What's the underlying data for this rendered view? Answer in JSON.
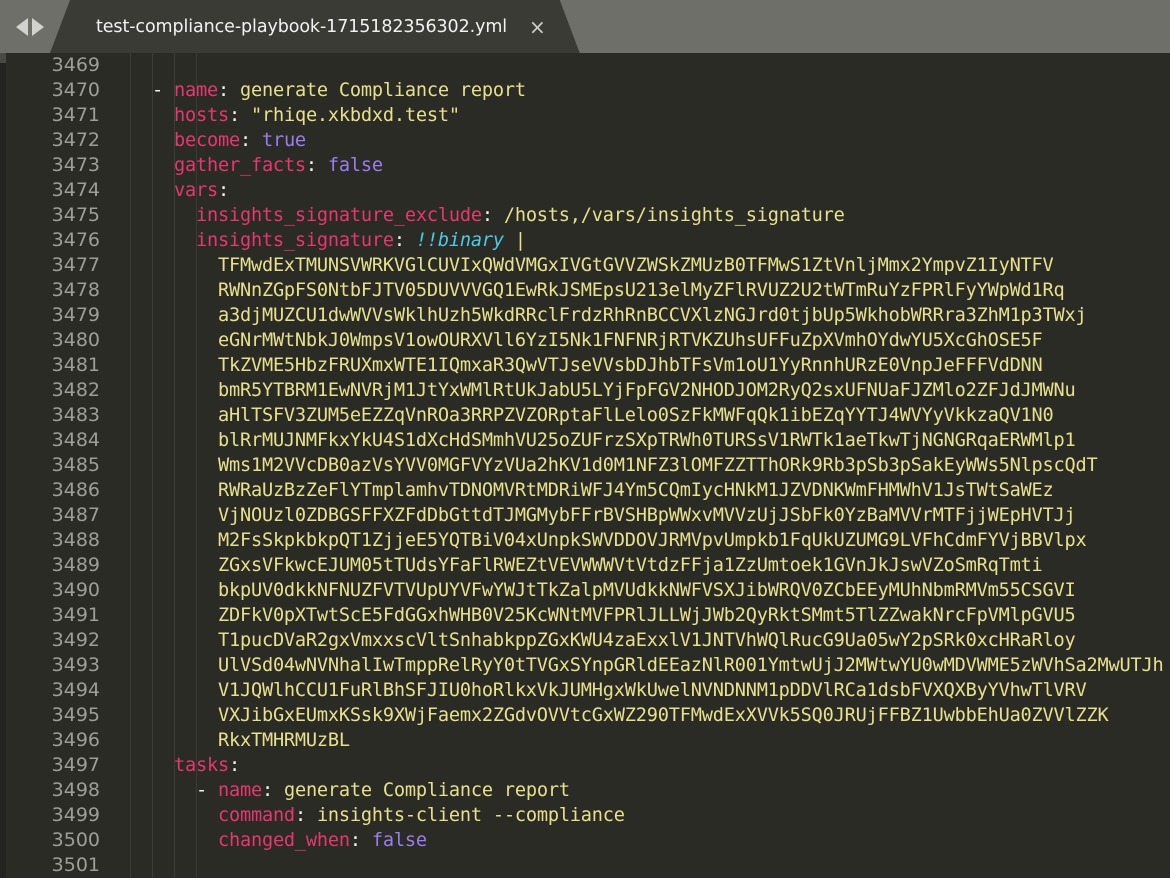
{
  "window": {
    "background": "#2b2b26",
    "tabbar_background": "#6e6f69",
    "tab_background": "#3b3b36"
  },
  "tabbar": {
    "nav_back_icon": "triangle-left",
    "nav_forward_icon": "triangle-right",
    "tab": {
      "title": "test-compliance-playbook-1715182356302.yml",
      "close_label": "×"
    }
  },
  "editor": {
    "language": "yaml",
    "colors": {
      "line_number": "#9d9e97",
      "key": "#e8366f",
      "string": "#e7e08c",
      "boolean": "#9a7ef0",
      "tag": "#4ec9e8",
      "punctuation": "#f2f2ef"
    },
    "first_visible_line": 3469,
    "lines": [
      {
        "num": "3469",
        "indent": 0,
        "tokens": []
      },
      {
        "num": "3470",
        "indent": 0,
        "tokens": [
          {
            "c": "p",
            "v": "  - "
          },
          {
            "c": "k",
            "v": "name"
          },
          {
            "c": "p",
            "v": ": "
          },
          {
            "c": "s",
            "v": "generate Compliance report"
          }
        ]
      },
      {
        "num": "3471",
        "indent": 0,
        "tokens": [
          {
            "c": "p",
            "v": "    "
          },
          {
            "c": "k",
            "v": "hosts"
          },
          {
            "c": "p",
            "v": ": "
          },
          {
            "c": "s",
            "v": "\"rhiqe.xkbdxd.test\""
          }
        ]
      },
      {
        "num": "3472",
        "indent": 0,
        "tokens": [
          {
            "c": "p",
            "v": "    "
          },
          {
            "c": "k",
            "v": "become"
          },
          {
            "c": "p",
            "v": ": "
          },
          {
            "c": "b",
            "v": "true"
          }
        ]
      },
      {
        "num": "3473",
        "indent": 0,
        "tokens": [
          {
            "c": "p",
            "v": "    "
          },
          {
            "c": "k",
            "v": "gather_facts"
          },
          {
            "c": "p",
            "v": ": "
          },
          {
            "c": "b",
            "v": "false"
          }
        ]
      },
      {
        "num": "3474",
        "indent": 0,
        "tokens": [
          {
            "c": "p",
            "v": "    "
          },
          {
            "c": "k",
            "v": "vars"
          },
          {
            "c": "p",
            "v": ":"
          }
        ]
      },
      {
        "num": "3475",
        "indent": 0,
        "tokens": [
          {
            "c": "p",
            "v": "      "
          },
          {
            "c": "k",
            "v": "insights_signature_exclude"
          },
          {
            "c": "p",
            "v": ": "
          },
          {
            "c": "s",
            "v": "/hosts,/vars/insights_signature"
          }
        ]
      },
      {
        "num": "3476",
        "indent": 0,
        "tokens": [
          {
            "c": "p",
            "v": "      "
          },
          {
            "c": "k",
            "v": "insights_signature"
          },
          {
            "c": "p",
            "v": ": "
          },
          {
            "c": "t",
            "v": "!!binary"
          },
          {
            "c": "p",
            "v": " "
          },
          {
            "c": "s",
            "v": "|"
          }
        ]
      },
      {
        "num": "3477",
        "indent": 0,
        "tokens": [
          {
            "c": "p",
            "v": "        "
          },
          {
            "c": "b64",
            "v": "TFMwdExTMUNSVWRKVGlCUVIxQWdVMGxIVGtGVVZWSkZMUzB0TFMwS1ZtVnljMmx2YmpvZ1IyNTFV"
          }
        ]
      },
      {
        "num": "3478",
        "indent": 0,
        "tokens": [
          {
            "c": "p",
            "v": "        "
          },
          {
            "c": "b64",
            "v": "RWNnZGpFS0NtbFJTV05DUVVVGQ1EwRkJSMEpsU213elMyZFlRVUZ2U2tWTmRuYzFPRlFyYWpWd1Rq"
          }
        ]
      },
      {
        "num": "3479",
        "indent": 0,
        "tokens": [
          {
            "c": "p",
            "v": "        "
          },
          {
            "c": "b64",
            "v": "a3djMUZCU1dwWVVsWklhUzh5WkdRRclFrdzRhRnBCCVXlzNGJrd0tjbUp5WkhobWRRra3ZhM1p3TWxj"
          }
        ]
      },
      {
        "num": "3480",
        "indent": 0,
        "tokens": [
          {
            "c": "p",
            "v": "        "
          },
          {
            "c": "b64",
            "v": "eGNrMWtNbkJ0WmpsV1owOURXVll6YzI5Nk1FNFNRjRTVKZUhsUFFuZpXVmhOYdwYU5XcGhOSE5F"
          }
        ]
      },
      {
        "num": "3481",
        "indent": 0,
        "tokens": [
          {
            "c": "p",
            "v": "        "
          },
          {
            "c": "b64",
            "v": "TkZVME5HbzFRUXmxWTE1IQmxaR3QwVTJseVVsbDJhbTFsVm1oU1YyRnnhURzE0VnpJeFFFVdDNN"
          }
        ]
      },
      {
        "num": "3482",
        "indent": 0,
        "tokens": [
          {
            "c": "p",
            "v": "        "
          },
          {
            "c": "b64",
            "v": "bmR5YTBRM1EwNVRjM1JtYxWMlRtUkJabU5LYjFpFGV2NHODJOM2RyQ2sxUFNUaFJZMlo2ZFJdJMWNu"
          }
        ]
      },
      {
        "num": "3483",
        "indent": 0,
        "tokens": [
          {
            "c": "p",
            "v": "        "
          },
          {
            "c": "b64",
            "v": "aHlTSFV3ZUM5eEZZqVnROa3RRPZVZORptaFlLelo0SzFkMWFqQk1ibEZqYYTJ4WVYyVkkzaQV1N0"
          }
        ]
      },
      {
        "num": "3484",
        "indent": 0,
        "tokens": [
          {
            "c": "p",
            "v": "        "
          },
          {
            "c": "b64",
            "v": "blRrMUJNMFkxYkU4S1dXcHdSMmhVU25oZUFrzSXpTRWh0TURSsV1RWTk1aeTkwTjNGNGRqaERWMlp1"
          }
        ]
      },
      {
        "num": "3485",
        "indent": 0,
        "tokens": [
          {
            "c": "p",
            "v": "        "
          },
          {
            "c": "b64",
            "v": "Wms1M2VVcDB0azVsYVV0MGFVYzVUa2hKV1d0M1NFZ3lOMFZZTThORk9Rb3pSb3pSakEyWWs5NlpscQdT"
          }
        ]
      },
      {
        "num": "3486",
        "indent": 0,
        "tokens": [
          {
            "c": "p",
            "v": "        "
          },
          {
            "c": "b64",
            "v": "RWRaUzBzZeFlYTmplamhvTDNOMVRtMDRiWFJ4Ym5CQmIycHNkM1JZVDNKWmFHMWhV1JsTWtSaWEz"
          }
        ]
      },
      {
        "num": "3487",
        "indent": 0,
        "tokens": [
          {
            "c": "p",
            "v": "        "
          },
          {
            "c": "b64",
            "v": "VjNOUzl0ZDBGSFFXZFdDbGttdTJMGMybFFrBVSHBpWWxvMVVzUjJSbFk0YzBaMVVrMTFjjWEpHVTJj"
          }
        ]
      },
      {
        "num": "3488",
        "indent": 0,
        "tokens": [
          {
            "c": "p",
            "v": "        "
          },
          {
            "c": "b64",
            "v": "M2FsSkpkbkpQT1ZjjeE5YQTBiV04xUnpkSWVDDOVJRMVpvUmpkb1FqUkUZUMG9LVFhCdmFYVjBBVlpx"
          }
        ]
      },
      {
        "num": "3489",
        "indent": 0,
        "tokens": [
          {
            "c": "p",
            "v": "        "
          },
          {
            "c": "b64",
            "v": "ZGxsVFkwcEJUM05tTUdsYFaFlRWEZtVEVWWWVtVtdzFFja1ZzUmtoek1GVnJkJswVZoSmRqTmti"
          }
        ]
      },
      {
        "num": "3490",
        "indent": 0,
        "tokens": [
          {
            "c": "p",
            "v": "        "
          },
          {
            "c": "b64",
            "v": "bkpUV0dkkNFNUZFVTVUpUYVFwYWJtTkZalpMVUdkkNWFVSXJibWRQV0ZCbEEyMUhNbmRMVm55CSGVI"
          }
        ]
      },
      {
        "num": "3491",
        "indent": 0,
        "tokens": [
          {
            "c": "p",
            "v": "        "
          },
          {
            "c": "b64",
            "v": "ZDFkV0pXTwtScE5FdGGxhWHB0V25KcWNtMVFPRlJLLWjJWb2QyRktSMmt5TlZZwakNrcFpVMlpGVU5"
          }
        ]
      },
      {
        "num": "3492",
        "indent": 0,
        "tokens": [
          {
            "c": "p",
            "v": "        "
          },
          {
            "c": "b64",
            "v": "T1pucDVaR2gxVmxxscVltSnhabkppZGxKWU4zaExxlV1JNTVhWQlRucG9Ua05wY2pSRk0xcHRaRloy"
          }
        ]
      },
      {
        "num": "3493",
        "indent": 0,
        "tokens": [
          {
            "c": "p",
            "v": "        "
          },
          {
            "c": "b64",
            "v": "UlVSd04wNVNhalIwTmppRelRyY0tTVGxSYnpGRldEEazNlR001YmtwUjJ2MWtwYU0wMDVWME5zWVhSa2MwUTJh"
          }
        ]
      },
      {
        "num": "3494",
        "indent": 0,
        "tokens": [
          {
            "c": "p",
            "v": "        "
          },
          {
            "c": "b64",
            "v": "V1JQWlhCCU1FuRlBhSFJIU0hoRlkxVkJUMHgxWkUwelNVNDNNM1pDDVlRCa1dsbFVXQXByYVhwTlVRV"
          }
        ]
      },
      {
        "num": "3495",
        "indent": 0,
        "tokens": [
          {
            "c": "p",
            "v": "        "
          },
          {
            "c": "b64",
            "v": "VXJibGxEUmxKSsk9XWjFaemx2ZGdvOVVtcGxWZ290TFMwdExXVVk5SQ0JRUjFFBZ1UwbbEhUa0ZVVlZZK"
          }
        ]
      },
      {
        "num": "3496",
        "indent": 0,
        "tokens": [
          {
            "c": "p",
            "v": "        "
          },
          {
            "c": "b64",
            "v": "RkxTMHRMUzBL"
          }
        ]
      },
      {
        "num": "3497",
        "indent": 0,
        "tokens": [
          {
            "c": "p",
            "v": "    "
          },
          {
            "c": "k",
            "v": "tasks"
          },
          {
            "c": "p",
            "v": ":"
          }
        ]
      },
      {
        "num": "3498",
        "indent": 0,
        "tokens": [
          {
            "c": "p",
            "v": "      - "
          },
          {
            "c": "k",
            "v": "name"
          },
          {
            "c": "p",
            "v": ": "
          },
          {
            "c": "s",
            "v": "generate Compliance report"
          }
        ]
      },
      {
        "num": "3499",
        "indent": 0,
        "tokens": [
          {
            "c": "p",
            "v": "        "
          },
          {
            "c": "k",
            "v": "command"
          },
          {
            "c": "p",
            "v": ": "
          },
          {
            "c": "s",
            "v": "insights-client --compliance"
          }
        ]
      },
      {
        "num": "3500",
        "indent": 0,
        "tokens": [
          {
            "c": "p",
            "v": "        "
          },
          {
            "c": "k",
            "v": "changed_when"
          },
          {
            "c": "p",
            "v": ": "
          },
          {
            "c": "b",
            "v": "false"
          }
        ]
      },
      {
        "num": "3501",
        "indent": 0,
        "tokens": []
      }
    ]
  }
}
